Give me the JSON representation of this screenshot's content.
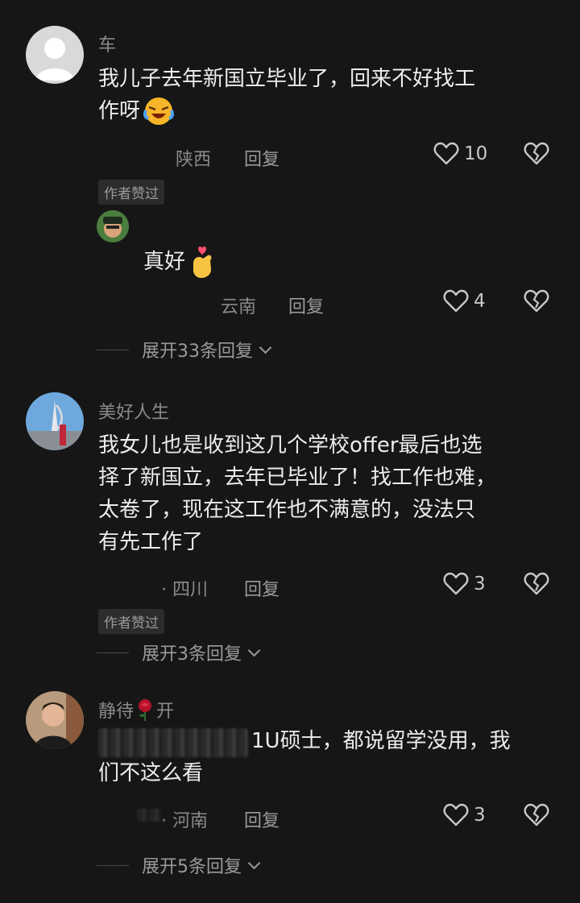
{
  "comments": [
    {
      "username": "车",
      "text_line1": "我儿子去年新国立毕业了，回来不好找工",
      "text_line2": "作呀",
      "location": "陕西",
      "reply_label": "回复",
      "likes": "10",
      "badge": "作者赞过",
      "avatar_icon": "default-user-icon",
      "emoji_icon": "crying-laughing-emoji",
      "sub_reply": {
        "text": "真好",
        "emoji_icon": "finger-heart-emoji",
        "location": "云南",
        "reply_label": "回复",
        "likes": "4"
      },
      "expand_label": "展开33条回复"
    },
    {
      "username": "美好人生",
      "text_lines": [
        "我女儿也是收到这几个学校offer最后也选",
        "择了新国立，去年已毕业了！找工作也难，",
        "太卷了，现在这工作也不满意的，没法只",
        "有先工作了"
      ],
      "location": "· 四川",
      "reply_label": "回复",
      "likes": "3",
      "badge": "作者赞过",
      "expand_label": "展开3条回复"
    },
    {
      "username_pre": "静待",
      "username_post": "开",
      "rose_icon": "rose-emoji",
      "text_line1_suffix": "1U硕士，都说留学没用，我",
      "text_line2": "们不这么看",
      "location": "· 河南",
      "reply_label": "回复",
      "likes": "3",
      "expand_label": "展开5条回复"
    }
  ],
  "colors": {
    "background": "#161616",
    "text": "#ececec",
    "muted": "#8a8a8a"
  }
}
